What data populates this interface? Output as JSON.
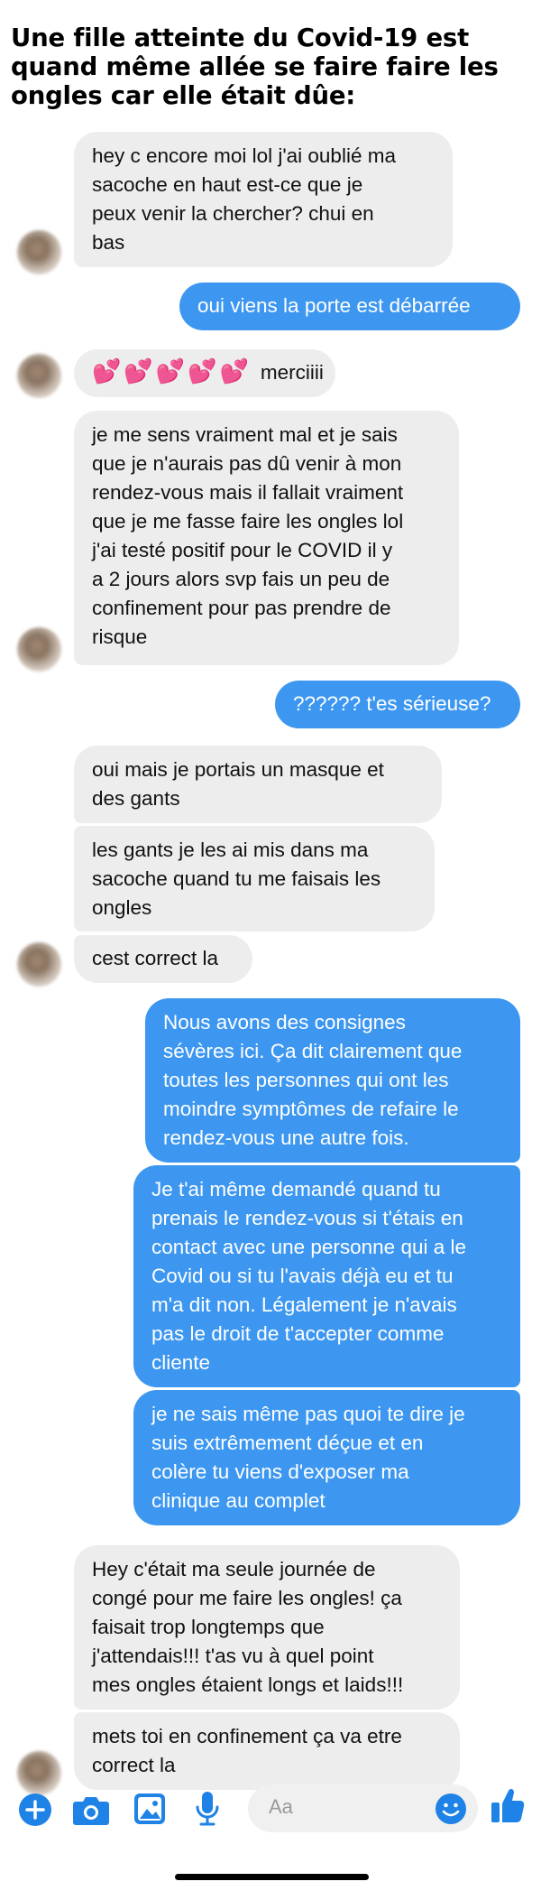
{
  "headline": "Une fille atteinte du Covid-19 est quand même allée se faire faire les ongles car elle était dûe:",
  "messages": [
    {
      "text": "hey c encore moi lol j'ai oublié ma\nsacoche en haut est-ce que je\npeux venir la chercher? chui en\nbas"
    },
    {
      "text": "oui viens la porte est débarrée"
    },
    {
      "hearts": "💕💕💕💕💕",
      "text": "merciiii"
    },
    {
      "text": "je me sens vraiment mal et je sais\nque je n'aurais pas dû venir à mon\nrendez-vous mais il fallait vraiment\nque je me fasse faire les ongles lol\nj'ai testé positif pour le COVID il y\na 2 jours alors svp fais un peu de\nconfinement pour pas prendre de\nrisque"
    },
    {
      "text": "?????? t'es sérieuse?"
    },
    {
      "text": "oui mais je portais un masque et\ndes gants"
    },
    {
      "text": "les gants je les ai mis dans ma\nsacoche quand tu me faisais les\nongles"
    },
    {
      "text": "cest correct la"
    },
    {
      "text": "Nous avons des consignes\nsévères ici. Ça dit clairement que\ntoutes les personnes qui ont les\nmoindre symptômes de refaire le\nrendez-vous une autre fois."
    },
    {
      "text": "Je t'ai même demandé quand tu\nprenais le rendez-vous si t'étais en\ncontact avec une personne qui a le\nCovid ou si tu l'avais déjà eu et tu\nm'a dit non. Légalement je n'avais\npas le droit de t'accepter comme\ncliente"
    },
    {
      "text": "je ne sais même pas quoi te dire je\nsuis extrêmement déçue et en\ncolère tu viens d'exposer ma\nclinique au complet"
    },
    {
      "text": "Hey c'était ma seule journée de\ncongé pour me faire les ongles! ça\nfaisait trop longtemps que\nj'attendais!!! t'as vu à quel point\nmes ongles étaient longs et laids!!!"
    },
    {
      "text": "mets toi en confinement ça va etre\ncorrect la"
    }
  ],
  "composer": {
    "placeholder": "Aa",
    "icons": [
      "plus-icon",
      "camera-icon",
      "gallery-icon",
      "microphone-icon",
      "emoji-icon",
      "thumbs-up-icon"
    ]
  },
  "colors": {
    "incoming_bubble": "#ededed",
    "outgoing_bubble": "#3d97f0",
    "accent": "#1e82e6"
  }
}
